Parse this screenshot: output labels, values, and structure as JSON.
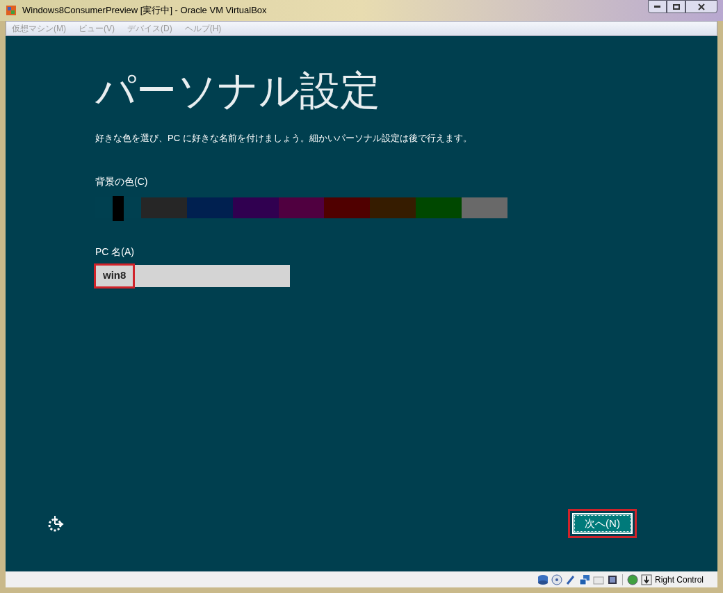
{
  "window": {
    "title": "Windows8ConsumerPreview [実行中] - Oracle VM VirtualBox"
  },
  "menu": [
    {
      "label": "仮想マシン(M)",
      "disabled": true
    },
    {
      "label": "ビュー(V)",
      "disabled": true
    },
    {
      "label": "デバイス(D)",
      "disabled": true
    },
    {
      "label": "ヘルプ(H)",
      "disabled": true
    }
  ],
  "setup": {
    "heading": "パーソナル設定",
    "description": "好きな色を選び、PC に好きな名前を付けましょう。細かいパーソナル設定は後で行えます。",
    "color_label": "背景の色(C)",
    "swatches": [
      {
        "color": "#004050",
        "selected": true
      },
      {
        "color": "#262626",
        "selected": false
      },
      {
        "color": "#002050",
        "selected": false
      },
      {
        "color": "#300050",
        "selected": false
      },
      {
        "color": "#500040",
        "selected": false
      },
      {
        "color": "#500000",
        "selected": false
      },
      {
        "color": "#361c00",
        "selected": false
      },
      {
        "color": "#004800",
        "selected": false
      },
      {
        "color": "#696969",
        "selected": false
      }
    ],
    "name_label": "PC 名(A)",
    "name_value": "win8",
    "next_button": "次へ(N)"
  },
  "status_bar": {
    "host_key": "Right Control"
  }
}
